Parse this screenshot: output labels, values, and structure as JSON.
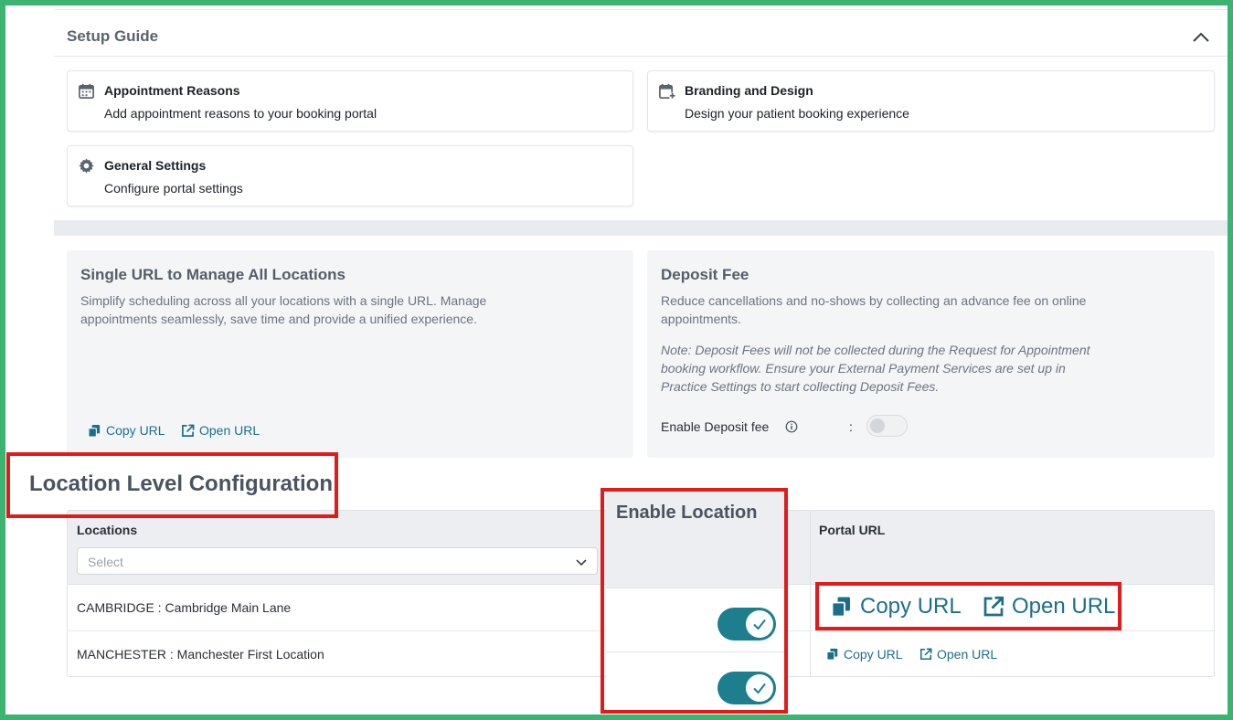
{
  "setup_guide": {
    "title": "Setup Guide",
    "cards": [
      {
        "title": "Appointment Reasons",
        "desc": "Add appointment reasons to your booking portal",
        "icon": "calendar-icon"
      },
      {
        "title": "Branding and Design",
        "desc": "Design your patient booking experience",
        "icon": "calendar-plus-icon"
      },
      {
        "title": "General Settings",
        "desc": "Configure portal settings",
        "icon": "gear-icon"
      }
    ]
  },
  "single_url": {
    "title": "Single URL to Manage All Locations",
    "desc_line1": "Simplify scheduling across all your locations with a single URL. Manage",
    "desc_line2": "appointments seamlessly, save time and provide a unified experience.",
    "copy_url": "Copy URL",
    "open_url": "Open URL"
  },
  "deposit_fee": {
    "title": "Deposit Fee",
    "desc_line1": "Reduce cancellations and no-shows by collecting an advance fee on online",
    "desc_line2": "appointments.",
    "note_line1": "Note: Deposit Fees will not be collected during the Request for Appointment",
    "note_line2": "booking workflow. Ensure your External Payment Services are set up in",
    "note_line3": "Practice Settings to start collecting Deposit Fees.",
    "enable_label": "Enable Deposit fee",
    "colon": ":",
    "enabled": false
  },
  "location_config": {
    "heading": "Location Level Configuration",
    "columns": {
      "locations": "Locations",
      "enable": "Enable Location",
      "portal": "Portal URL"
    },
    "select_placeholder": "Select",
    "rows": [
      {
        "name": "CAMBRIDGE : Cambridge Main Lane",
        "enabled": true,
        "copy_url": "Copy URL",
        "open_url": "Open URL"
      },
      {
        "name": "MANCHESTER : Manchester First Location",
        "enabled": true,
        "copy_url": "Copy URL",
        "open_url": "Open URL"
      }
    ]
  },
  "colors": {
    "accent": "#1d7f8e",
    "link": "#1c6f8a",
    "highlight": "#e01b1b",
    "border_frame": "#3cb371"
  }
}
